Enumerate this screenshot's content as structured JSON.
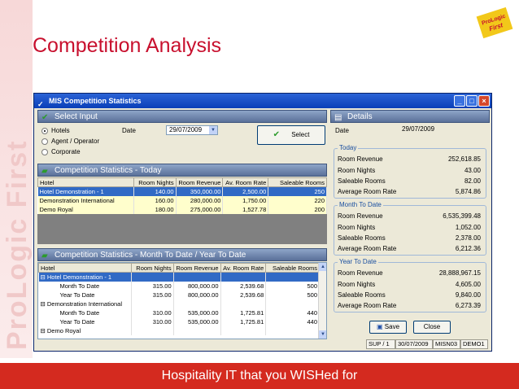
{
  "slide": {
    "title": "Competition Analysis",
    "watermark": "ProLogic First",
    "logo_text": "ProLogic First",
    "footer": "Hospitality IT that you WISHed for"
  },
  "window": {
    "title": "MIS Competition Statistics",
    "buttons": {
      "minimize": "_",
      "maximize": "□",
      "close": "×"
    }
  },
  "select_input": {
    "header": "Select Input",
    "options": [
      {
        "label": "Hotels",
        "selected": true
      },
      {
        "label": "Agent / Operator",
        "selected": false
      },
      {
        "label": "Corporate",
        "selected": false
      }
    ],
    "date_label": "Date",
    "date_value": "29/07/2009",
    "select_button": "Select"
  },
  "today": {
    "header": "Competition Statistics - Today",
    "columns": [
      "Hotel",
      "Room Nights",
      "Room Revenue",
      "Av. Room Rate",
      "Saleable Rooms"
    ],
    "rows": [
      [
        "Hotel Demonstration - 1",
        "140.00",
        "350,000.00",
        "2,500.00",
        "250"
      ],
      [
        "Demonstration International",
        "160.00",
        "280,000.00",
        "1,750.00",
        "220"
      ],
      [
        "Demo Royal",
        "180.00",
        "275,000.00",
        "1,527.78",
        "200"
      ]
    ]
  },
  "mtd": {
    "header": "Competition Statistics - Month To Date / Year To Date",
    "columns": [
      "Hotel",
      "Room Nights",
      "Room Revenue",
      "Av. Room Rate",
      "Saleable Rooms"
    ],
    "rows": [
      {
        "label": "Hotel Demonstration - 1",
        "level": 0,
        "values": [
          "",
          "",
          "",
          ""
        ]
      },
      {
        "label": "Month To Date",
        "level": 1,
        "values": [
          "315.00",
          "800,000.00",
          "2,539.68",
          "500"
        ]
      },
      {
        "label": "Year To Date",
        "level": 1,
        "values": [
          "315.00",
          "800,000.00",
          "2,539.68",
          "500"
        ]
      },
      {
        "label": "Demonstration International",
        "level": 0,
        "values": [
          "",
          "",
          "",
          ""
        ]
      },
      {
        "label": "Month To Date",
        "level": 1,
        "values": [
          "310.00",
          "535,000.00",
          "1,725.81",
          "440"
        ]
      },
      {
        "label": "Year To Date",
        "level": 1,
        "values": [
          "310.00",
          "535,000.00",
          "1,725.81",
          "440"
        ]
      },
      {
        "label": "Demo Royal",
        "level": 0,
        "values": [
          "",
          "",
          "",
          ""
        ]
      }
    ]
  },
  "details": {
    "header": "Details",
    "date_label": "Date",
    "date_value": "29/07/2009",
    "today": {
      "label": "Today",
      "rows": [
        [
          "Room Revenue",
          "252,618.85"
        ],
        [
          "Room Nights",
          "43.00"
        ],
        [
          "Saleable Rooms",
          "82.00"
        ],
        [
          "Average Room Rate",
          "5,874.86"
        ]
      ]
    },
    "mtd": {
      "label": "Month To Date",
      "rows": [
        [
          "Room Revenue",
          "6,535,399.48"
        ],
        [
          "Room Nights",
          "1,052.00"
        ],
        [
          "Saleable Rooms",
          "2,378.00"
        ],
        [
          "Average Room Rate",
          "6,212.36"
        ]
      ]
    },
    "ytd": {
      "label": "Year To Date",
      "rows": [
        [
          "Room Revenue",
          "28,888,967.15"
        ],
        [
          "Room Nights",
          "4,605.00"
        ],
        [
          "Saleable Rooms",
          "9,840.00"
        ],
        [
          "Average Room Rate",
          "6,273.39"
        ]
      ]
    },
    "save_button": "Save",
    "close_button": "Close"
  },
  "status": [
    "SUP / 1",
    "30/07/2009",
    "MISN03",
    "DEMO1"
  ]
}
